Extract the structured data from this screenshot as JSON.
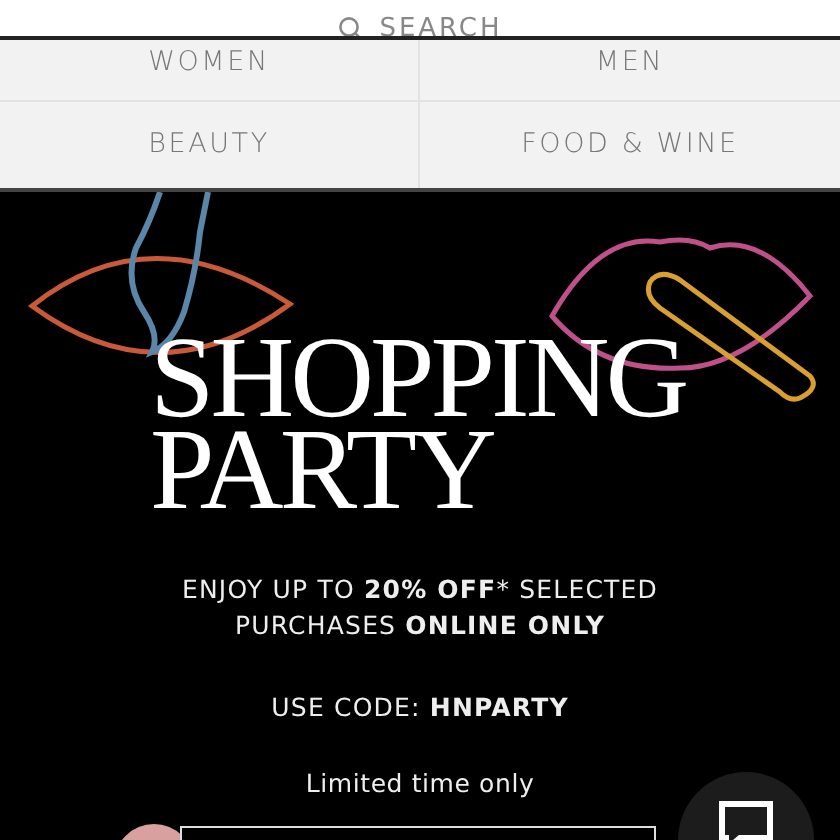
{
  "search": {
    "label": "SEARCH"
  },
  "categories": [
    {
      "label": "WOMEN"
    },
    {
      "label": "MEN"
    },
    {
      "label": "BEAUTY"
    },
    {
      "label": "FOOD & WINE"
    }
  ],
  "hero": {
    "title_lines": [
      "SHOPPING",
      "PARTY"
    ],
    "offer": "ENJOY UP TO **20% OFF*** SELECTED PURCHASES **ONLINE ONLY**",
    "code": "USE CODE: **HNPARTY**",
    "note": "Limited time only"
  }
}
